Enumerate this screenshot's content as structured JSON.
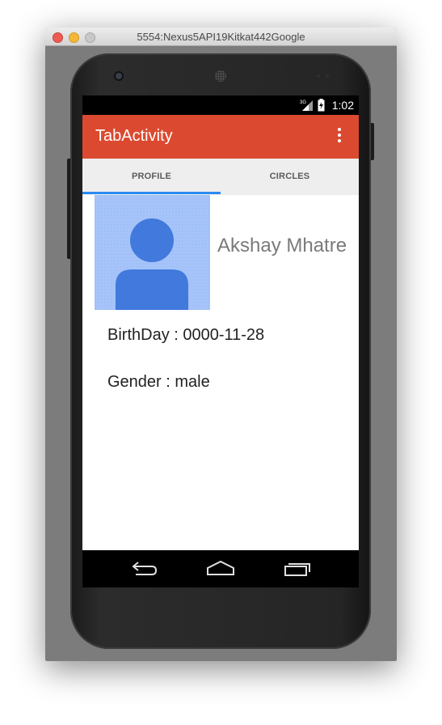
{
  "window": {
    "title": "5554:Nexus5API19Kitkat442Google"
  },
  "status_bar": {
    "network": "3G",
    "time": "1:02"
  },
  "app_bar": {
    "title": "TabActivity",
    "menu_icon": "overflow-menu-icon"
  },
  "tabs": [
    {
      "label": "PROFILE",
      "selected": true
    },
    {
      "label": "CIRCLES",
      "selected": false
    }
  ],
  "profile": {
    "name": "Akshay Mhatre",
    "birthday": "BirthDay : 0000-11-28",
    "gender": "Gender : male",
    "avatar_icon": "default-avatar-icon"
  },
  "nav_bar": {
    "icons": [
      "back-icon",
      "home-icon",
      "recent-apps-icon"
    ]
  },
  "colors": {
    "app_bar": "#db4a30",
    "tab_indicator": "#2a8bf2",
    "tab_bar": "#eeeeee",
    "avatar_bg": "#a8c5fa",
    "avatar_fg": "#4179dc"
  }
}
